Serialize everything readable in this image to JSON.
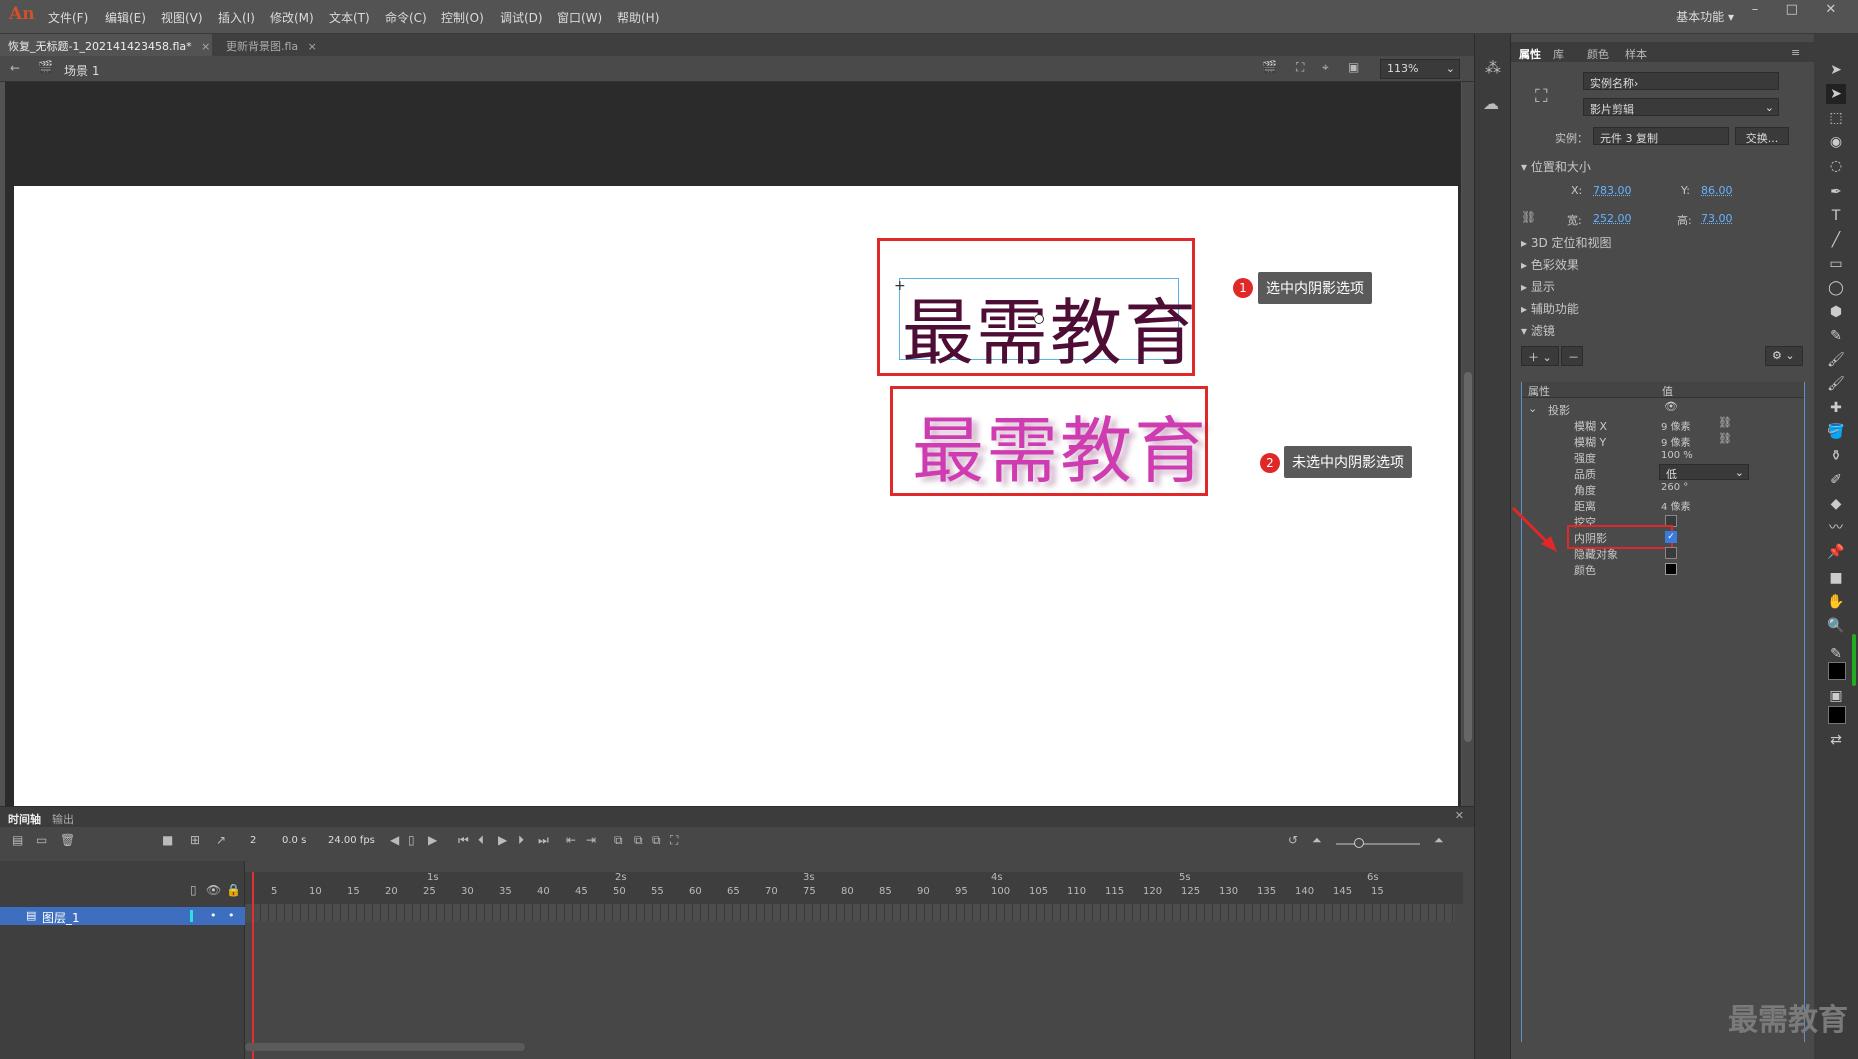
{
  "app": {
    "logo": "An"
  },
  "menu": [
    "文件(F)",
    "编辑(E)",
    "视图(V)",
    "插入(I)",
    "修改(M)",
    "文本(T)",
    "命令(C)",
    "控制(O)",
    "调试(D)",
    "窗口(W)",
    "帮助(H)"
  ],
  "workspace": "基本功能 ▾",
  "doc_tabs": [
    {
      "label": "恢复_无标题-1_202141423458.fla*",
      "active": true
    },
    {
      "label": "更新背景图.fla",
      "active": false
    }
  ],
  "scene": {
    "label": "场景 1",
    "zoom": "113%"
  },
  "stage": {
    "text_a": "最需教育",
    "text_b": "最需教育",
    "callout_1_num": "1",
    "callout_1": "选中内阴影选项",
    "callout_2_num": "2",
    "callout_2": "未选中内阴影选项"
  },
  "timeline": {
    "tabs": [
      "时间轴",
      "输出"
    ],
    "frame": "2",
    "time": "0.0 s",
    "fps": "24.00 fps",
    "layer_name": "图层_1",
    "seconds": [
      "1s",
      "2s",
      "3s",
      "4s",
      "5s",
      "6s"
    ],
    "frame_numbers": [
      "5",
      "10",
      "15",
      "20",
      "25",
      "30",
      "35",
      "40",
      "45",
      "50",
      "55",
      "60",
      "65",
      "70",
      "75",
      "80",
      "85",
      "90",
      "95",
      "100",
      "105",
      "110",
      "115",
      "120",
      "125",
      "130",
      "135",
      "140",
      "145",
      "15"
    ]
  },
  "properties": {
    "tabs": [
      "属性",
      "库",
      "颜色",
      "样本"
    ],
    "instance_name_placeholder": "实例名称›",
    "instance_type": "影片剪辑",
    "instance_label": "实例：",
    "instance_of": "元件 3 复制",
    "swap_button": "交换...",
    "sections": {
      "pos_size": "位置和大小",
      "three_d": "3D 定位和视图",
      "color_effect": "色彩效果",
      "display": "显示",
      "accessibility": "辅助功能",
      "filters": "滤镜"
    },
    "x_label": "X:",
    "x": "783.00",
    "y_label": "Y:",
    "y": "86.00",
    "w_label": "宽:",
    "w": "252.00",
    "h_label": "高:",
    "h": "73.00",
    "filter_header": {
      "prop": "属性",
      "value": "值"
    },
    "filter_name": "投影",
    "filter_rows": [
      {
        "name": "模糊 X",
        "value": "9 像素"
      },
      {
        "name": "模糊 Y",
        "value": "9 像素"
      },
      {
        "name": "强度",
        "value": "100 %"
      },
      {
        "name": "品质",
        "value": "低"
      },
      {
        "name": "角度",
        "value": "260 °"
      },
      {
        "name": "距离",
        "value": "4 像素"
      },
      {
        "name": "挖空",
        "value": ""
      },
      {
        "name": "内阴影",
        "value": ""
      },
      {
        "name": "隐藏对象",
        "value": ""
      },
      {
        "name": "颜色",
        "value": ""
      }
    ],
    "knockout_checked": false,
    "inner_shadow_checked": true,
    "hide_object_checked": false
  },
  "watermark": "最需教育",
  "colors": {
    "accent": "#3d6ebf",
    "highlight": "#e02828",
    "text_a": "#4d0d35",
    "text_b": "#cf3cb2"
  }
}
